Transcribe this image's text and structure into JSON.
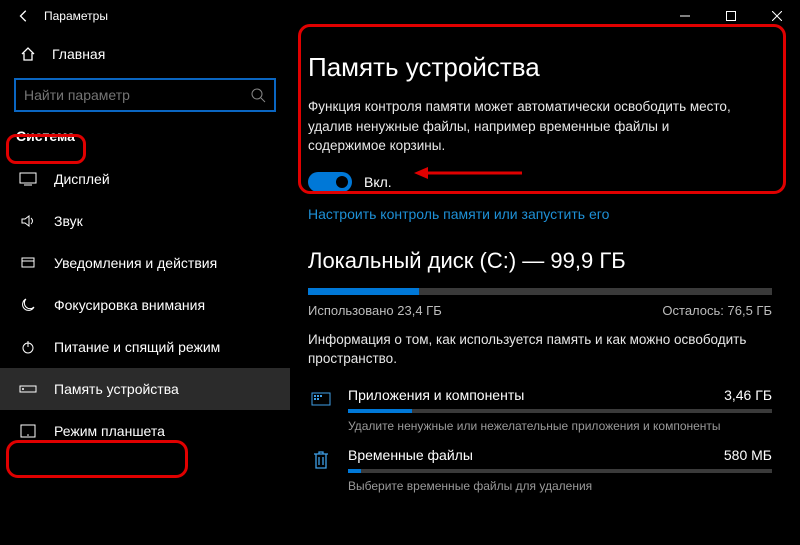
{
  "titlebar": {
    "title": "Параметры"
  },
  "sidebar": {
    "home": "Главная",
    "search_placeholder": "Найти параметр",
    "section": "Система",
    "items": [
      {
        "label": "Дисплей"
      },
      {
        "label": "Звук"
      },
      {
        "label": "Уведомления и действия"
      },
      {
        "label": "Фокусировка внимания"
      },
      {
        "label": "Питание и спящий режим"
      },
      {
        "label": "Память устройства",
        "selected": true
      },
      {
        "label": "Режим планшета"
      }
    ]
  },
  "main": {
    "title": "Память устройства",
    "description": "Функция контроля памяти может автоматически освободить место, удалив ненужные файлы, например временные файлы и содержимое корзины.",
    "toggle_label": "Вкл.",
    "toggle_on": true,
    "config_link": "Настроить контроль памяти или запустить его",
    "disk": {
      "title": "Локальный диск (C:) — 99,9 ГБ",
      "used_label": "Использовано 23,4 ГБ",
      "free_label": "Осталось: 76,5 ГБ",
      "used_percent": 24
    },
    "info": "Информация о том, как используется память и как можно освободить пространство.",
    "items": [
      {
        "name": "Приложения и компоненты",
        "size": "3,46 ГБ",
        "sub": "Удалите ненужные или нежелательные приложения и компоненты",
        "percent": 15
      },
      {
        "name": "Временные файлы",
        "size": "580 МБ",
        "sub": "Выберите временные файлы для удаления",
        "percent": 3
      }
    ]
  }
}
